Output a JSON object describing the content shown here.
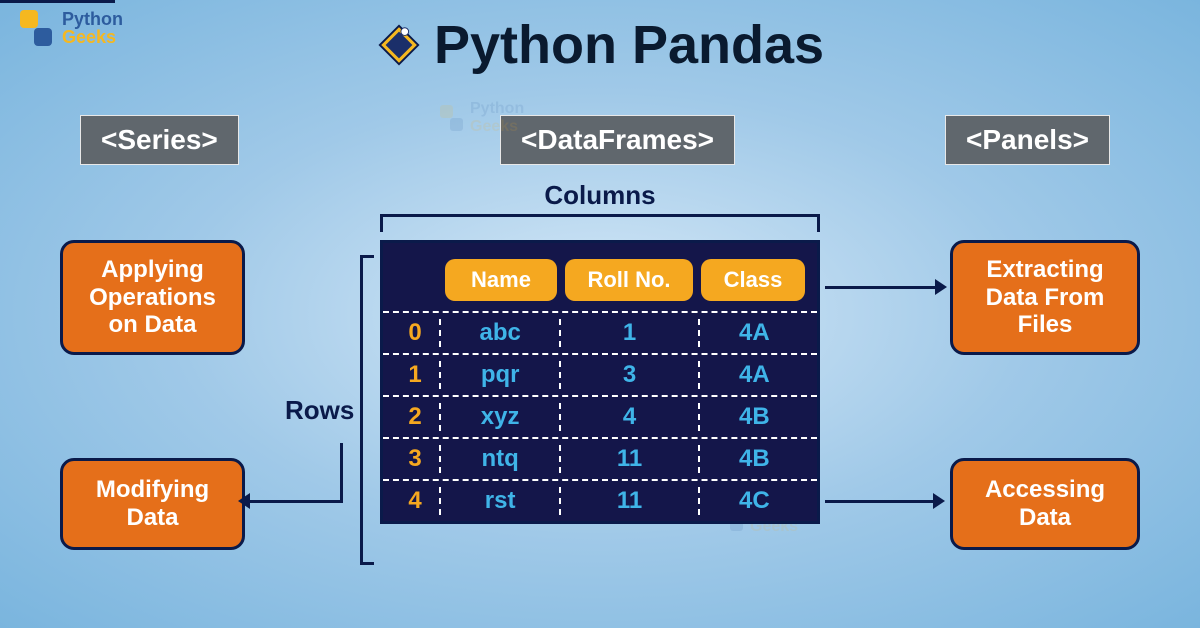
{
  "brand": {
    "line1": "Python",
    "line2": "Geeks"
  },
  "title": "Python Pandas",
  "tags": {
    "series": "<Series>",
    "dataframes": "<DataFrames>",
    "panels": "<Panels>"
  },
  "labels": {
    "columns": "Columns",
    "rows": "Rows"
  },
  "ops": {
    "tl": "Applying Operations on Data",
    "bl": "Modifying Data",
    "tr": "Extracting Data From Files",
    "br": "Accessing Data"
  },
  "table": {
    "headers": {
      "c1": "Name",
      "c2": "Roll No.",
      "c3": "Class"
    },
    "rows": [
      {
        "idx": "0",
        "name": "abc",
        "roll": "1",
        "cls": "4A"
      },
      {
        "idx": "1",
        "name": "pqr",
        "roll": "3",
        "cls": "4A"
      },
      {
        "idx": "2",
        "name": "xyz",
        "roll": "4",
        "cls": "4B"
      },
      {
        "idx": "3",
        "name": "ntq",
        "roll": "11",
        "cls": "4B"
      },
      {
        "idx": "4",
        "name": "rst",
        "roll": "11",
        "cls": "4C"
      }
    ]
  }
}
